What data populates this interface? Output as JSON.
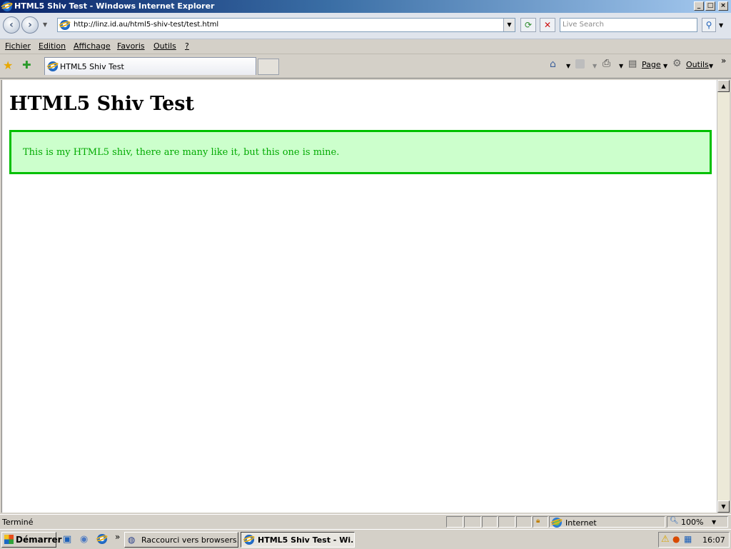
{
  "window": {
    "title": "HTML5 Shiv Test - Windows Internet Explorer"
  },
  "address": {
    "url": "http://linz.id.au/html5-shiv-test/test.html"
  },
  "search": {
    "placeholder": "Live Search"
  },
  "menu": {
    "items": [
      "Fichier",
      "Edition",
      "Affichage",
      "Favoris",
      "Outils",
      "?"
    ]
  },
  "tab": {
    "label": "HTML5 Shiv Test"
  },
  "commandbar": {
    "page_label": "Page",
    "tools_label": "Outils"
  },
  "page": {
    "heading": "HTML5 Shiv Test",
    "notice": "This is my HTML5 shiv, there are many like it, but this one is mine."
  },
  "status": {
    "text": "Terminé",
    "zone": "Internet",
    "zoom": "100%"
  },
  "taskbar": {
    "start_label": "Démarrer",
    "buttons": [
      "Raccourci vers browsers...",
      "HTML5 Shiv Test - Wi..."
    ],
    "clock": "16:07"
  },
  "colors": {
    "notice_border": "#00c000",
    "notice_bg": "#ccffcc",
    "notice_text": "#00aa00",
    "titlebar": "#0a246a"
  },
  "icons": [
    "ie-icon",
    "back-icon",
    "forward-icon",
    "refresh-icon",
    "stop-icon",
    "search-icon",
    "favorites-star-icon",
    "add-favorite-icon",
    "home-icon",
    "feeds-icon",
    "print-icon",
    "page-icon",
    "tools-gear-icon",
    "globe-icon",
    "zoom-icon"
  ]
}
